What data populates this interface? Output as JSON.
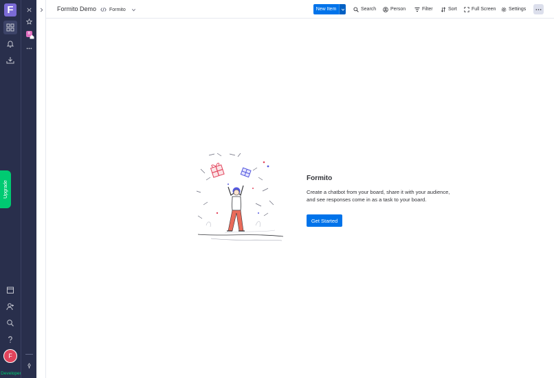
{
  "rail": {
    "logo_letter": "F",
    "upgrade_label": "Upgrade",
    "avatar_initial": "F",
    "developer_label": "Developer",
    "icons": [
      "workspaces-icon",
      "bell-icon",
      "inbox-icon",
      "calendar-icon",
      "invite-icon",
      "search-icon",
      "help-icon"
    ]
  },
  "workspace": {
    "avatar_initial": "B"
  },
  "header": {
    "board_title": "Formito Demo",
    "view_tab_label": "Formito",
    "new_item_label": "New Item",
    "search_label": "Search",
    "person_label": "Person",
    "filter_label": "Filter",
    "sort_label": "Sort",
    "fullscreen_label": "Full Screen",
    "settings_label": "Settings"
  },
  "empty_state": {
    "title": "Formito",
    "description": "Create a chatbot from your board, share it with your audience, and see responses come in as a task to your board.",
    "cta_label": "Get Started"
  },
  "colors": {
    "rail_bg": "#292f4c",
    "primary": "#0073ea",
    "upgrade": "#00ca72",
    "avatar": "#e2445c",
    "logo": "#7b6bd6"
  }
}
